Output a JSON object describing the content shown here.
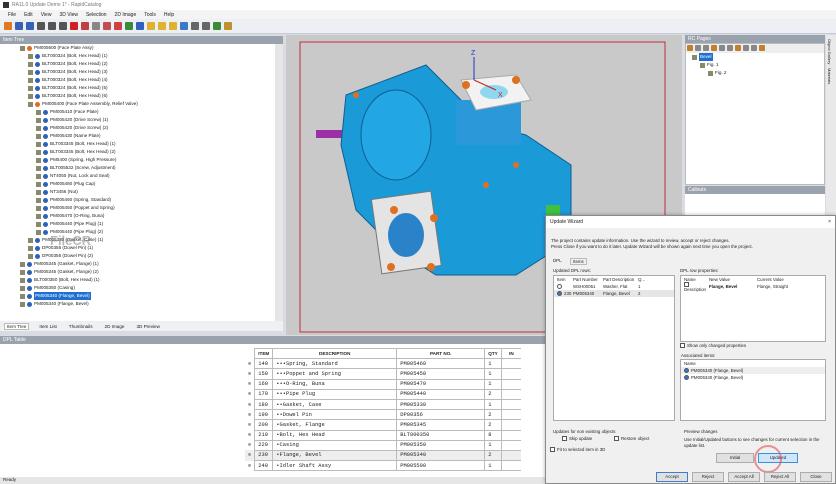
{
  "window": {
    "title": "RA11.0 Update Demo 1* - RapidCatalog"
  },
  "menu": [
    "File",
    "Edit",
    "View",
    "3D View",
    "Selection",
    "2D Image",
    "Tools",
    "Help"
  ],
  "item_tree": {
    "title": "Item Tree",
    "items": [
      {
        "label": "PM005600 (Face Plate Assy)",
        "level": 1,
        "type": "asm"
      },
      {
        "label": "BLT000324 (Bolt, Hex Head) (1)",
        "level": 2
      },
      {
        "label": "BLT000324 (Bolt, Hex Head) (2)",
        "level": 2
      },
      {
        "label": "BLT000324 (Bolt, Hex Head) (3)",
        "level": 2
      },
      {
        "label": "BLT000324 (Bolt, Hex Head) (4)",
        "level": 2
      },
      {
        "label": "BLT000324 (Bolt, Hex Head) (5)",
        "level": 2
      },
      {
        "label": "BLT000324 (Bolt, Hex Head) (6)",
        "level": 2
      },
      {
        "label": "PM005400 (Face Plate Assembly, Relief Valve)",
        "level": 2,
        "type": "asm"
      },
      {
        "label": "PM005410 (Face Plate)",
        "level": 3
      },
      {
        "label": "PM005420 (Drive Screw) (1)",
        "level": 3
      },
      {
        "label": "PM005420 (Drive Screw) (2)",
        "level": 3
      },
      {
        "label": "PM005430 (Name Plate)",
        "level": 3
      },
      {
        "label": "BLT003345 (Bolt, Hex Head) (1)",
        "level": 3
      },
      {
        "label": "BLT003345 (Bolt, Hex Head) (2)",
        "level": 3
      },
      {
        "label": "PM5400 (Spring, High Pressure)",
        "level": 3
      },
      {
        "label": "BLT005532 (Screw, Adjustment)",
        "level": 3
      },
      {
        "label": "NT4050 (Nut, Lock and Seal)",
        "level": 3
      },
      {
        "label": "PM005480 (Plug Cap)",
        "level": 3
      },
      {
        "label": "NT3456 (Nut)",
        "level": 3
      },
      {
        "label": "PM005460 (Spring, Standard)",
        "level": 3
      },
      {
        "label": "PM005450 (Poppet and Spring)",
        "level": 3
      },
      {
        "label": "PM005470 (O-Ring, Buna)",
        "level": 3
      },
      {
        "label": "PM005440 (Pipe Plug) (1)",
        "level": 3
      },
      {
        "label": "PM005440 (Pipe Plug) (2)",
        "level": 3
      },
      {
        "label": "PM005330 (Gasket, Case) (1)",
        "level": 2
      },
      {
        "label": "DP00356 (Dowel Pin) (1)",
        "level": 2
      },
      {
        "label": "DP00356 (Dowel Pin) (2)",
        "level": 2
      },
      {
        "label": "PM005345 (Gasket, Flange) (1)",
        "level": 1
      },
      {
        "label": "PM005345 (Gasket, Flange) (2)",
        "level": 1
      },
      {
        "label": "BLT000350 (Bolt, Hex Head) (1)",
        "level": 1
      },
      {
        "label": "PM005350 (Casing)",
        "level": 1
      },
      {
        "label": "PM005340 (Flange, Bevel)",
        "level": 1,
        "selected": true
      },
      {
        "label": "PM005340 (Flange, Bevel)",
        "level": 1
      }
    ],
    "tabs": [
      "Item Tree",
      "Item List",
      "Thumbnails",
      "2D Image",
      "3D Preview"
    ]
  },
  "watermark": {
    "text": "FileCR",
    ".com": ".com"
  },
  "viewport": {
    "axes": [
      "Z",
      "X"
    ]
  },
  "rc_pages": {
    "title": "RC Pages",
    "items": [
      {
        "label": "Bevel",
        "selected": true
      },
      {
        "label": "Fig. 1"
      },
      {
        "label": "Fig. 2"
      }
    ]
  },
  "callouts": {
    "title": "Callouts"
  },
  "side_tabs": [
    "Object Gallery",
    "Materials"
  ],
  "dpl": {
    "title": "DPL Table",
    "columns": [
      "ITEM",
      "DESCRIPTION",
      "PART NO.",
      "QTY",
      "IN"
    ],
    "rows": [
      [
        "140",
        "•••Spring, Standard",
        "PM005460",
        "1"
      ],
      [
        "150",
        "•••Poppet and Spring",
        "PM005450",
        "1"
      ],
      [
        "160",
        "•••O-Ring, Buna",
        "PM005470",
        "1"
      ],
      [
        "170",
        "•••Pipe Plug",
        "PM005440",
        "2"
      ],
      [
        "180",
        "••Gasket, Case",
        "PM005330",
        "1"
      ],
      [
        "190",
        "••Dowel Pin",
        "DP00356",
        "2"
      ],
      [
        "200",
        "•Gasket, Flange",
        "PM005345",
        "2"
      ],
      [
        "210",
        "•Bolt, Hex Head",
        "BLT000350",
        "8"
      ],
      [
        "220",
        "•Casing",
        "PM005350",
        "1"
      ],
      [
        "230",
        "•Flange, Bevel",
        "PM005340",
        "2"
      ],
      [
        "240",
        "•Idler Shaft Assy",
        "PM005500",
        "1"
      ]
    ],
    "highlighted_item": "230"
  },
  "status": "Ready",
  "wizard": {
    "title": "Update Wizard",
    "close": "×",
    "intro1": "The project contains update information. Use the wizard to review, accept or reject changes.",
    "intro2": "Press Close if you want to do it later. Update Wizard will be shown again next time you open the project.",
    "tabs": [
      "DPL",
      "Items"
    ],
    "updated_rows_label": "Updated DPL rows:",
    "rows_columns": [
      "Item",
      "Part Number",
      "Part Description",
      "Q..."
    ],
    "rows": [
      [
        "",
        "WSH00051",
        "Washer, Flat",
        "1"
      ],
      [
        "230",
        "PM005340",
        "Flange, Bevel",
        "2"
      ]
    ],
    "props_label": "DPL row properties:",
    "props_columns": [
      "Name",
      "New Value",
      "Current Value"
    ],
    "props": [
      [
        "Description",
        "Flange, Bevel",
        "Flange, Straight"
      ]
    ],
    "show_changed": "Show only changed properties",
    "assoc_label": "Associated items:",
    "assoc_column": "Name",
    "assoc_items": [
      "PM005340 (Flange, Bevel)",
      "PM005340 (Flange, Bevel)"
    ],
    "nonexist_label": "Updates for non existing objects",
    "skip_update": "Skip update",
    "restore_object": "Restore object",
    "fit_selected": "Fit to selected item in 3D",
    "preview_label": "Preview changes",
    "preview_text": "Use Initial/Updated buttons to see changes for current selection in the update list.",
    "initial": "Initial",
    "updated": "Updated",
    "buttons": [
      "Accept",
      "Reject",
      "Accept All",
      "Reject All",
      "Close"
    ]
  }
}
